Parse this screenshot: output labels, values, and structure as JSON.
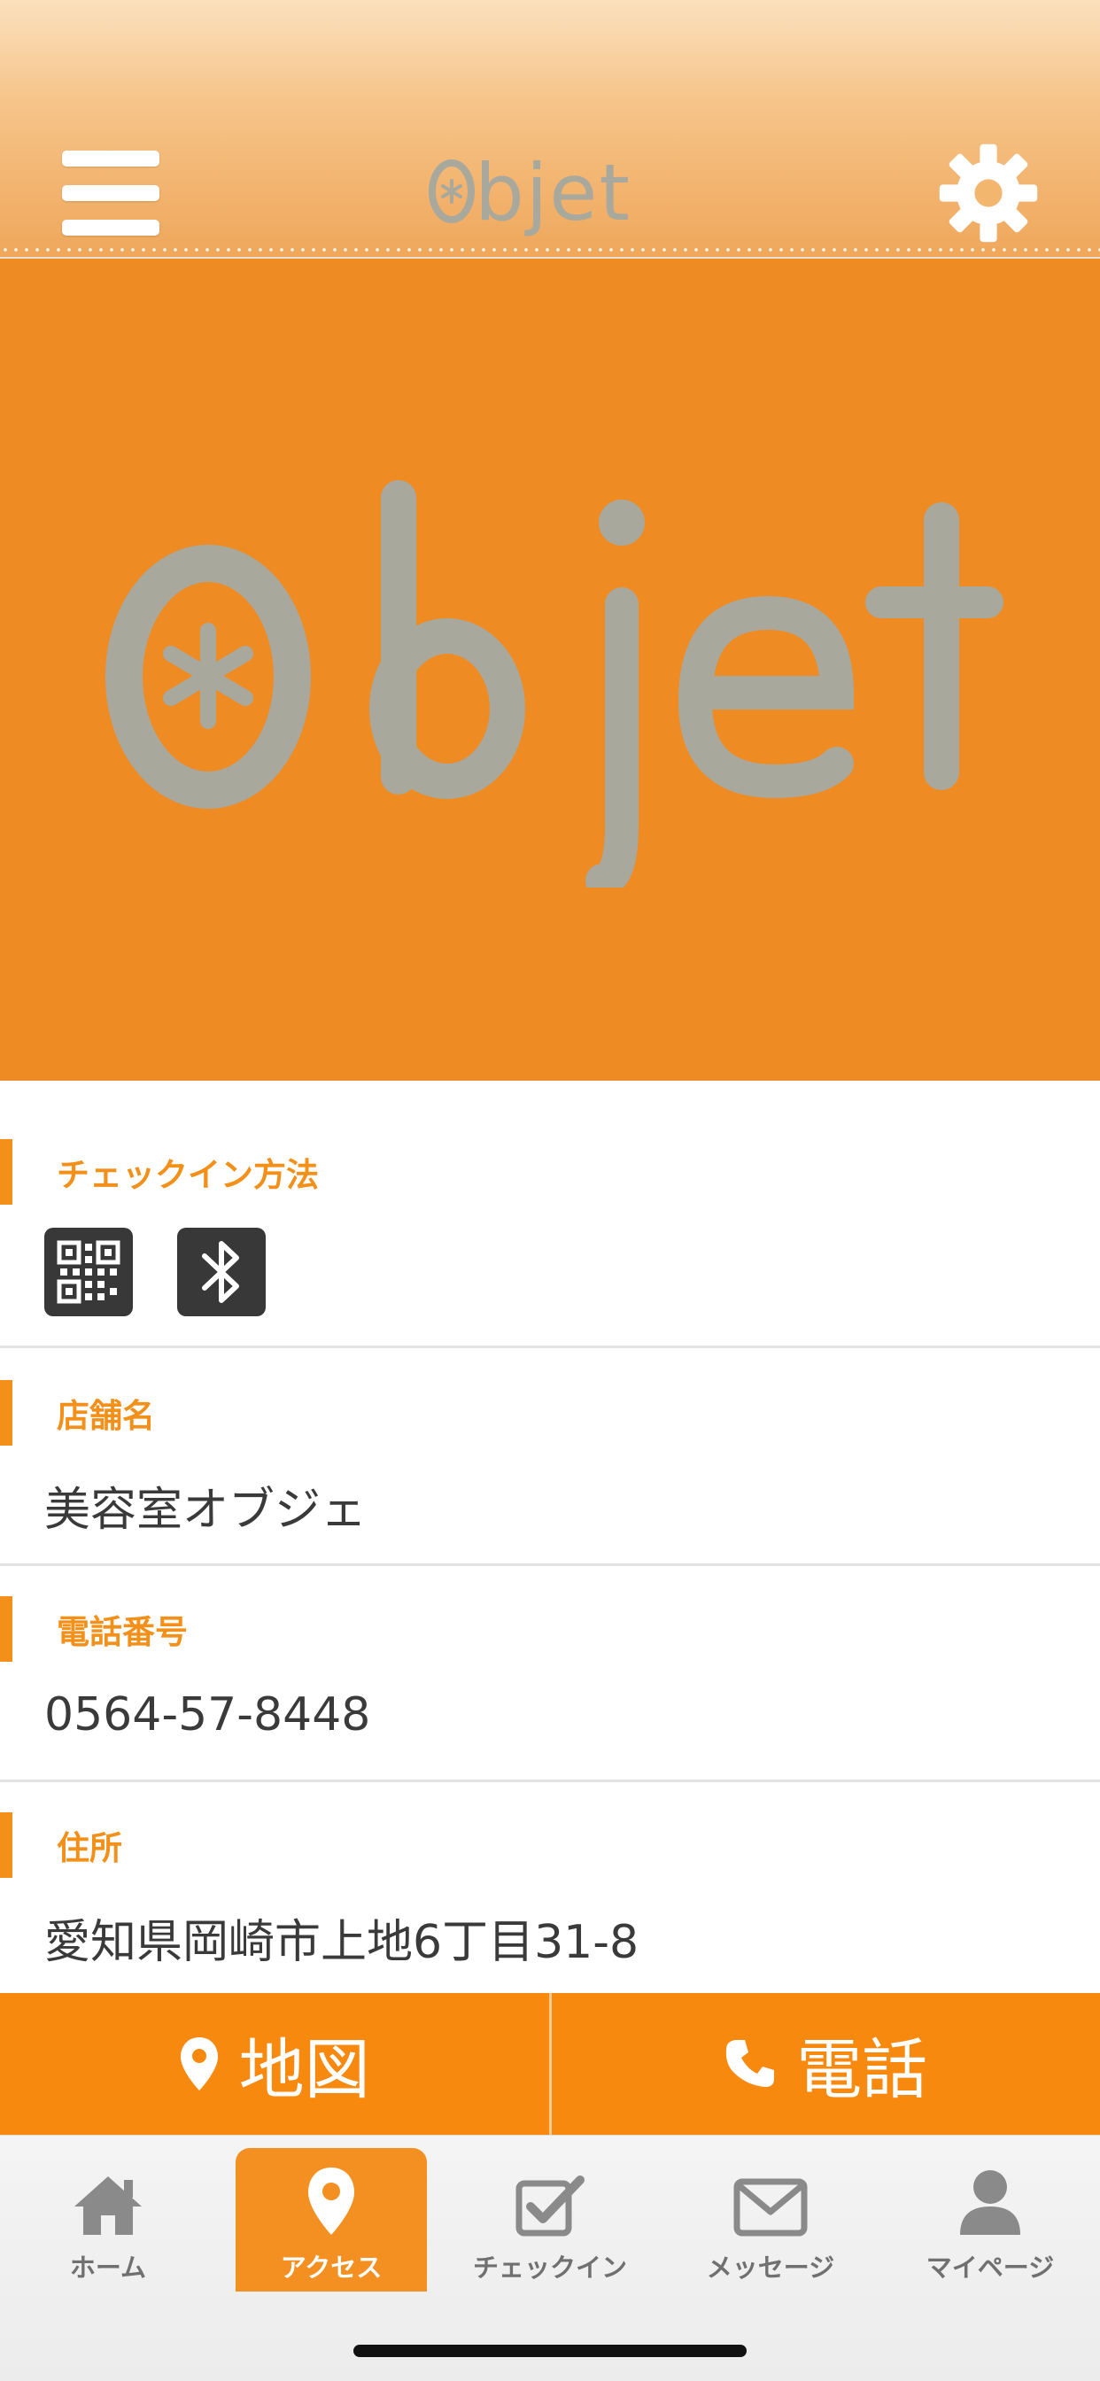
{
  "header": {
    "logo_text": "Objet"
  },
  "hero": {
    "logo_text": "Objet"
  },
  "sections": {
    "checkin": {
      "label": "チェックイン方法",
      "icons": [
        "qr-code-icon",
        "bluetooth-icon"
      ]
    },
    "store": {
      "label": "店舗名",
      "value": "美容室オブジェ"
    },
    "phone": {
      "label": "電話番号",
      "value": "0564-57-8448"
    },
    "address": {
      "label": "住所",
      "value": "愛知県岡崎市上地6丁目31-8"
    }
  },
  "actions": {
    "map_label": "地図",
    "call_label": "電話"
  },
  "tabs": [
    {
      "label": "ホーム",
      "icon": "home-icon"
    },
    {
      "label": "アクセス",
      "icon": "map-pin-icon",
      "active": true
    },
    {
      "label": "チェックイン",
      "icon": "checkbox-icon"
    },
    {
      "label": "メッセージ",
      "icon": "envelope-icon"
    },
    {
      "label": "マイページ",
      "icon": "person-icon"
    }
  ],
  "colors": {
    "accent": "#f29019",
    "hero_bg": "#ef8b23",
    "logo_gray": "#a9a89d",
    "text": "#3a3a3a"
  }
}
